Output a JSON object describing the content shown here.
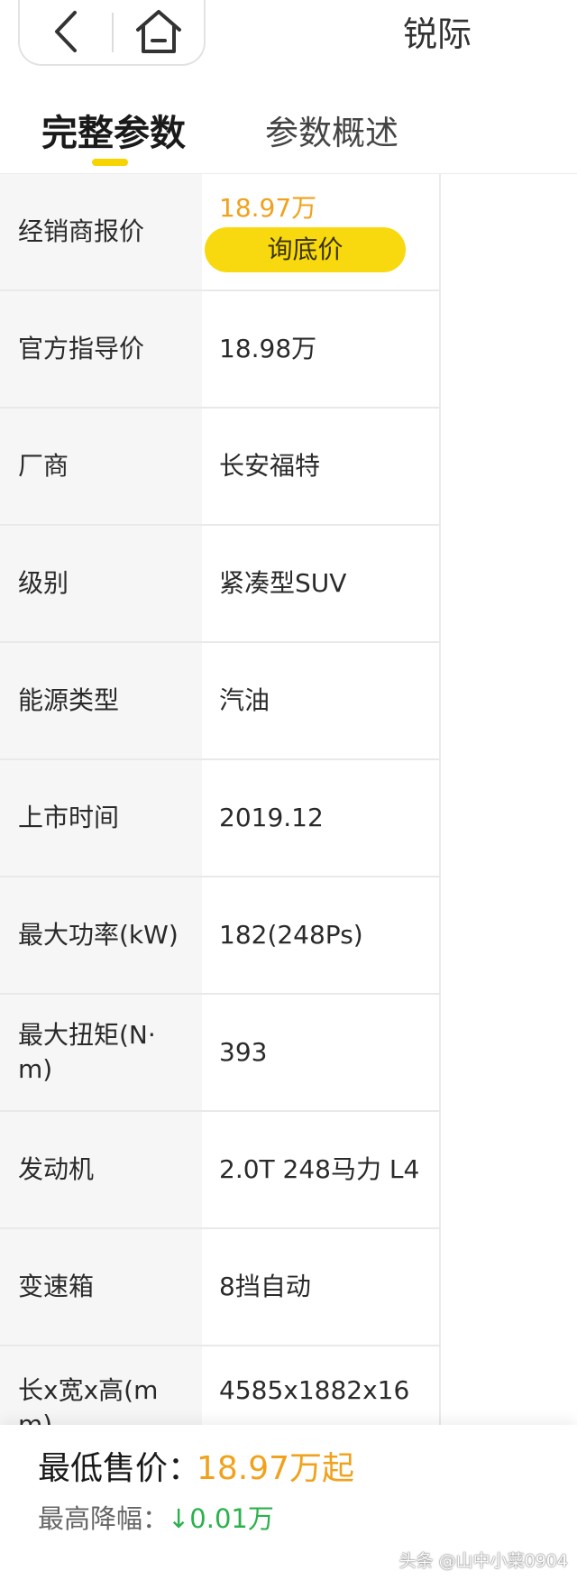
{
  "header": {
    "back_icon": "chevron-left-icon",
    "home_icon": "home-icon",
    "title": "锐际"
  },
  "tabs": [
    {
      "label": "完整参数",
      "active": true
    },
    {
      "label": "参数概述",
      "active": false
    }
  ],
  "specs": {
    "dealer": {
      "label": "经销商报价",
      "price": "18.97万",
      "button": "询底价"
    },
    "rows": [
      {
        "label": "官方指导价",
        "value": "18.98万"
      },
      {
        "label": "厂商",
        "value": "长安福特"
      },
      {
        "label": "级别",
        "value": "紧凑型SUV"
      },
      {
        "label": "能源类型",
        "value": "汽油"
      },
      {
        "label": "上市时间",
        "value": "2019.12"
      },
      {
        "label": "最大功率(kW)",
        "value": "182(248Ps)"
      },
      {
        "label": "最大扭矩(N·m)",
        "value": "393"
      },
      {
        "label": "发动机",
        "value": "2.0T 248马力 L4"
      },
      {
        "label": "变速箱",
        "value": "8挡自动"
      },
      {
        "label": "长x宽x高(mm)",
        "value": "4585x1882x16"
      }
    ]
  },
  "bottom": {
    "min_price_label": "最低售价：",
    "min_price_value": "18.97万起",
    "max_drop_label": "最高降幅：",
    "max_drop_value": "↓0.01万"
  },
  "watermark": "头条 @山中小菜0904",
  "colors": {
    "accent_yellow": "#f8d90f",
    "price_orange": "#f0a21c",
    "drop_green": "#2bb24c"
  }
}
